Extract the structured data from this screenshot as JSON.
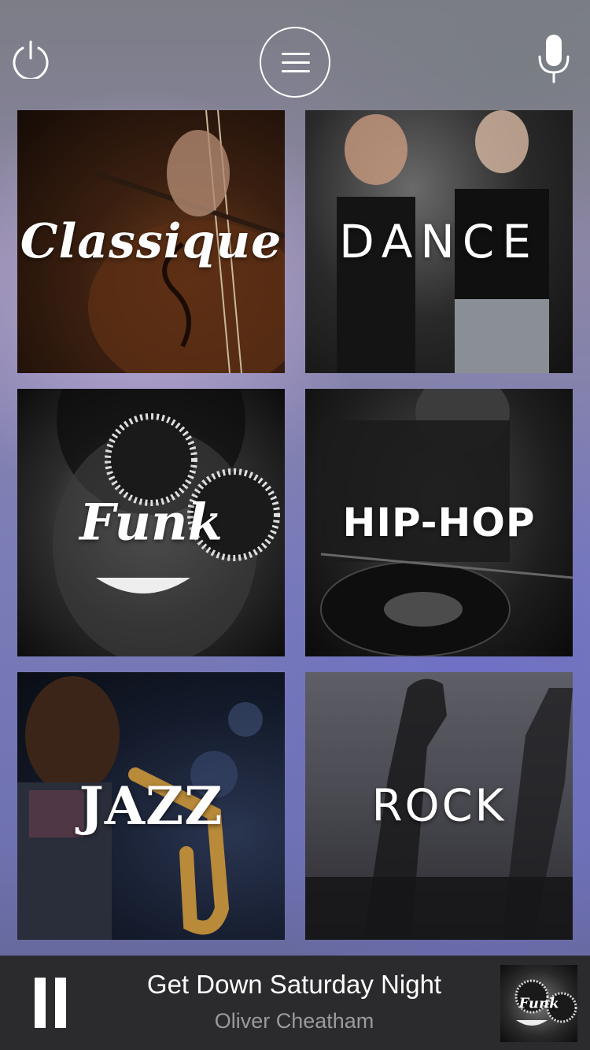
{
  "topbar": {
    "power_icon": "power-icon",
    "menu_icon": "hamburger-menu-icon",
    "mic_icon": "microphone-icon"
  },
  "genres": [
    {
      "id": "classique",
      "label": "Classique"
    },
    {
      "id": "dance",
      "label": "DANCE"
    },
    {
      "id": "funk",
      "label": "Funk"
    },
    {
      "id": "hiphop",
      "label": "HIP-HOP"
    },
    {
      "id": "jazz",
      "label": "JAZZ"
    },
    {
      "id": "rock",
      "label": "ROCK"
    }
  ],
  "now_playing": {
    "title": "Get Down Saturday Night",
    "artist": "Oliver Cheatham",
    "thumb_label": "Funk",
    "state_icon": "pause-icon"
  },
  "colors": {
    "background_accent": "#6f72b0",
    "player_bar": "#2b2b2d",
    "artist_text": "#9a9a9c"
  }
}
